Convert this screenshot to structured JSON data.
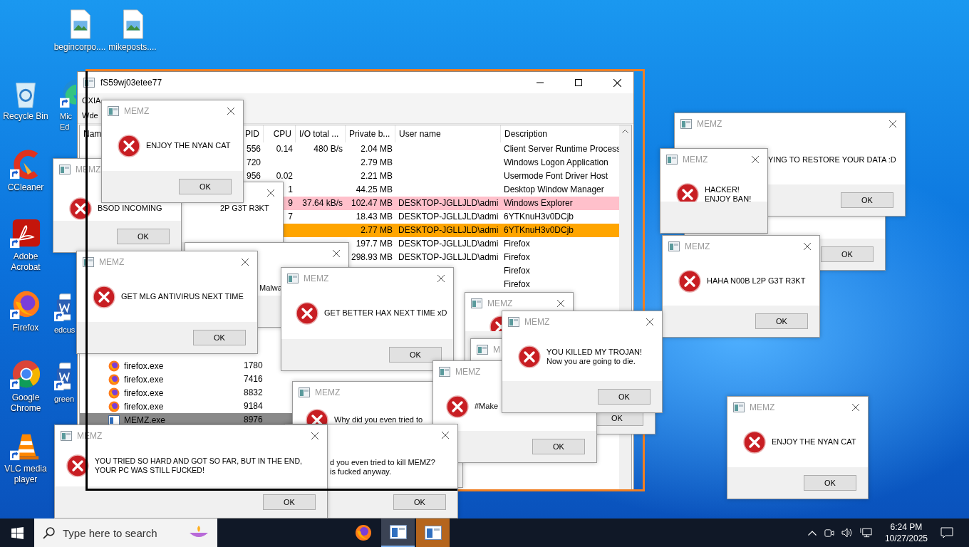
{
  "desktop_icons": [
    {
      "label": [
        "begincorpo...."
      ],
      "kind": "image"
    },
    {
      "label": [
        "mikeposts...."
      ],
      "kind": "image"
    },
    {
      "label": [
        "Recycle Bin"
      ],
      "kind": "recycle"
    },
    {
      "label": [
        "Mic",
        "Ed"
      ],
      "kind": "edge"
    },
    {
      "label": [
        "CCleaner"
      ],
      "kind": "ccleaner"
    },
    {
      "label": [
        "Adobe",
        "Acrobat"
      ],
      "kind": "acrobat"
    },
    {
      "label": [
        "Firefox"
      ],
      "kind": "firefox"
    },
    {
      "label": [
        "edcus"
      ],
      "kind": "word"
    },
    {
      "label": [
        "Google",
        "Chrome"
      ],
      "kind": "chrome"
    },
    {
      "label": [
        "green"
      ],
      "kind": "word"
    },
    {
      "label": [
        "VLC media",
        "player"
      ],
      "kind": "vlc"
    }
  ],
  "process_window": {
    "title": "fS59wj03etee77",
    "menu": "OXIA",
    "toolbar": "Wde",
    "columns": [
      "Nam",
      "PID",
      "CPU",
      "I/O total ...",
      "Private b...",
      "User name",
      "Description"
    ],
    "rows": [
      {
        "pid": "556",
        "cpu": "0.14",
        "io": "480 B/s",
        "private": "2.04 MB",
        "description": "Client Server Runtime Process",
        "selected": false
      },
      {
        "pid": "720",
        "private": "2.79 MB",
        "description": "Windows Logon Application",
        "selected": false
      },
      {
        "pid": "956",
        "cpu": "0.02",
        "private": "2.21 MB",
        "description": "Usermode Font Driver Host",
        "selected": false
      },
      {
        "cpu": "1",
        "private": "44.25 MB",
        "description": "Desktop Window Manager",
        "selected": false
      },
      {
        "cpu": "9",
        "io": "37.64 kB/s",
        "private": "102.47 MB",
        "user": "DESKTOP-JGLLJLD\\admi",
        "description": "Windows Explorer",
        "color": "#ffc0cb",
        "selected": false
      },
      {
        "cpu": "7",
        "private": "18.43 MB",
        "user": "DESKTOP-JGLLJLD\\admi",
        "description": "6YTKnuH3v0DCjb",
        "selected": false
      },
      {
        "private": "2.77 MB",
        "user": "DESKTOP-JGLLJLD\\admi",
        "description": "6YTKnuH3v0DCjb",
        "color": "#ffa500",
        "selected": false
      },
      {
        "private": "197.7 MB",
        "user": "DESKTOP-JGLLJLD\\admi",
        "description": "Firefox",
        "selected": false
      },
      {
        "private": "298.93 MB",
        "user": "DESKTOP-JGLLJLD\\admi",
        "description": "Firefox",
        "selected": false
      },
      {
        "description": "Firefox",
        "selected": false
      },
      {
        "description": "Firefox",
        "selected": false
      }
    ],
    "more_rows": [
      {
        "kind": "firefox",
        "name": "firefox.exe",
        "pid": "1780",
        "selected": false
      },
      {
        "kind": "firefox",
        "name": "firefox.exe",
        "pid": "7416",
        "selected": false
      },
      {
        "kind": "firefox",
        "name": "firefox.exe",
        "pid": "8832",
        "selected": false
      },
      {
        "kind": "firefox",
        "name": "firefox.exe",
        "pid": "9184",
        "selected": false
      },
      {
        "kind": "app",
        "name": "MEMZ.exe",
        "pid": "8976",
        "selected": true
      }
    ]
  },
  "dialogs": [
    {
      "button": "OK"
    },
    {
      "title": "MEMZ",
      "lines": [
        "YING TO RESTORE YOUR DATA :D"
      ],
      "button": "OK"
    },
    {
      "title": "MEMZ",
      "lines": [
        "HACKER!",
        "ENJOY BAN!"
      ]
    },
    {
      "title": "MEMZ",
      "lines": [
        "HAHA N00B L2P G3T R3KT"
      ],
      "button": "OK"
    },
    {
      "title": "MEMZ",
      "lines": [
        "ENJOY THE NYAN CAT"
      ],
      "button": "OK"
    },
    {
      "lines": [
        "2P G3T R3KT"
      ]
    },
    {
      "title": "MEMZ",
      "lines": [
        "BSOD INCOMING"
      ],
      "button": "OK"
    },
    {
      "title": "MEMZ",
      "lines": [
        "ENJOY THE NYAN CAT"
      ],
      "button": "OK"
    },
    {
      "lines": [
        "Malwa"
      ]
    },
    {
      "title": "MEMZ",
      "lines": [
        "GET MLG ANTIVIRUS NEXT TIME"
      ],
      "button": "OK"
    },
    {
      "title": "MEMZ",
      "lines": [
        "GET BETTER HAX NEXT TIME xD"
      ],
      "button": "OK"
    },
    {
      "title": "MEMZ"
    },
    {
      "title": "MEMZ",
      "lines": [
        "Why did you even tried to"
      ]
    },
    {
      "title": "M",
      "button": "OK"
    },
    {
      "title": "MEMZ",
      "lines": [
        "#Make"
      ],
      "button": "OK"
    },
    {
      "lines": [
        "d you even tried to kill MEMZ?",
        "is fucked anyway."
      ],
      "button": "OK"
    },
    {
      "title": "MEMZ",
      "lines": [
        "YOU KILLED MY TROJAN!",
        "Now you are going to die."
      ],
      "button": "OK"
    },
    {
      "title": "MEMZ",
      "lines": [
        "YOU TRIED SO HARD AND GOT SO FAR, BUT IN THE END,",
        "YOUR PC WAS STILL FUCKED!"
      ],
      "button": "OK"
    }
  ],
  "taskbar": {
    "search_placeholder": "Type here to search",
    "apps": [
      {
        "kind": "firefox",
        "active": false,
        "flashing": false
      },
      {
        "kind": "app",
        "active": true,
        "flashing": false
      },
      {
        "kind": "app",
        "active": false,
        "flashing": true
      }
    ],
    "time": "6:24 PM",
    "date": "10/27/2025"
  }
}
